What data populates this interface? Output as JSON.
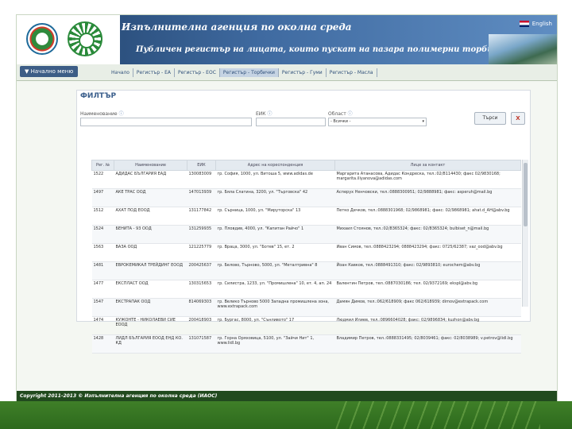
{
  "header": {
    "agency": "Изпълнителна агенция по околна среда",
    "subtitle": "Публичен регистър на лицата, които пускат на пазара полимерни торбички",
    "lang_label": "English"
  },
  "nav": {
    "home_menu": "Начално меню",
    "tabs": [
      {
        "label": "Начало"
      },
      {
        "label": "Регистър - ЕА"
      },
      {
        "label": "Регистър - ЕОС"
      },
      {
        "label": "Регистър - Торбички"
      },
      {
        "label": "Регистър - Гуми"
      },
      {
        "label": "Регистър - Масла"
      }
    ],
    "active_index": 3
  },
  "filter": {
    "title": "ФИЛТЪР",
    "name_label": "Наименование",
    "bulstat_label": "ЕИК",
    "region_label": "Област",
    "region_value": "- Всички -",
    "search_button": "Търси",
    "clear_button": "X"
  },
  "table": {
    "columns": [
      "Рег. №",
      "Наименование",
      "ЕИК",
      "Адрес на кореспонденция",
      "Лице за контакт"
    ],
    "rows": [
      {
        "reg": "1522",
        "name": "АДИДАС БЪЛГАРИЯ ЕАД",
        "eik": "130083009",
        "address": "гр. София, 1000, ул. Витоша 5, www.adidas.de",
        "contact": "Маргарита Атанасова, Адидас Кондреска, тел.:02/8114430; факс 02/9830168; margarita.iliyanova@adidas.com"
      },
      {
        "reg": "1497",
        "name": "АКЕ ТРАС ООД",
        "eik": "147013939",
        "address": "гр. Бяла Слатина, 3200, ул. \"Търговска\" 42",
        "contact": "Асперух Ненчовски, тел.:0888300951; 02/9888981; факс: asperuh@mail.bg"
      },
      {
        "reg": "1512",
        "name": "АХАТ ПОД ЕООД",
        "eik": "131177842",
        "address": "гр. Сърница, 1000, ул. \"Мируторска\" 13",
        "contact": "Петко Дечков, тел.:0888301968; 02/9868981; факс: 02/9868981; ahat.d_AH@abv.bg"
      },
      {
        "reg": "1524",
        "name": "БЕНИТА - 93 ООД",
        "eik": "131259935",
        "address": "гр. Пловдив, 4000, ул. \"Капитан Райчо\" 1",
        "contact": "Михаил Стоянов, тел.:02/8365324; факс: 02/8365324; bulbiset_n@mail.bg"
      },
      {
        "reg": "1563",
        "name": "ВАЗА ООД",
        "eik": "121225779",
        "address": "гр. Враца, 3000, ул. \"Ботев\" 15, ет. 2",
        "contact": "Иван Симов, тел.:0888423294; 0888423294; факс: 0725/62387; vaz_ood@abv.bg"
      },
      {
        "reg": "1481",
        "name": "ЕВРОКЕМИКАЛ ТРЕЙДИНГ ЕООД",
        "eik": "200425637",
        "address": "гр. Белово, Търново, 5000, ул. \"Металтривна\" 8",
        "contact": "Йоан Кавков, тел.:0888491310; факс: 02/9893810; eurochem@abv.bg"
      },
      {
        "reg": "1477",
        "name": "ЕКСПЛАСТ ООД",
        "eik": "130315653",
        "address": "гр. Силистра, 1233, ул. \"Промишлена\" 10, ет. 4, ап. 24",
        "contact": "Валентин Петров, тел.:0887030186; тел. 02/9372169; ekspl@abv.bg"
      },
      {
        "reg": "1547",
        "name": "ЕКСТРАПАК ООД",
        "eik": "814069303",
        "address": "гр. Велико Търново 5000 Западна промишлена зона, www.extrapack.com",
        "contact": "Дамян Димов, тел.:062/618909; факс 062/618939; dimov@extrapack.com"
      },
      {
        "reg": "1474",
        "name": "КУЖОНТЕ - НИКОЛАЕВИ СИЕ ЕООД",
        "eik": "200418903",
        "address": "гр. Бургас, 8000, ул. \"Сънливото\" 17",
        "contact": "Людмил Илиев, тел.:0896604028; факс: 02/9896834; kuzhon@abv.bg"
      },
      {
        "reg": "1428",
        "name": "ЛИДЛ БЪЛГАРИЯ ЕООД ЕНД КО. КД",
        "eik": "131071587",
        "address": "гр. Горна Оряховица, 5100, ул. \"Зайчи Нит\" 1, www.lidl.bg",
        "contact": "Владимир Петров, тел.:0888331495; 02/8039461; факс: 02/8038989; v.petrov@lidl.bg"
      }
    ]
  },
  "footer": {
    "copyright": "Copyright 2011-2013 © Изпълнителна агенция по околна среда (ИАОС)"
  }
}
